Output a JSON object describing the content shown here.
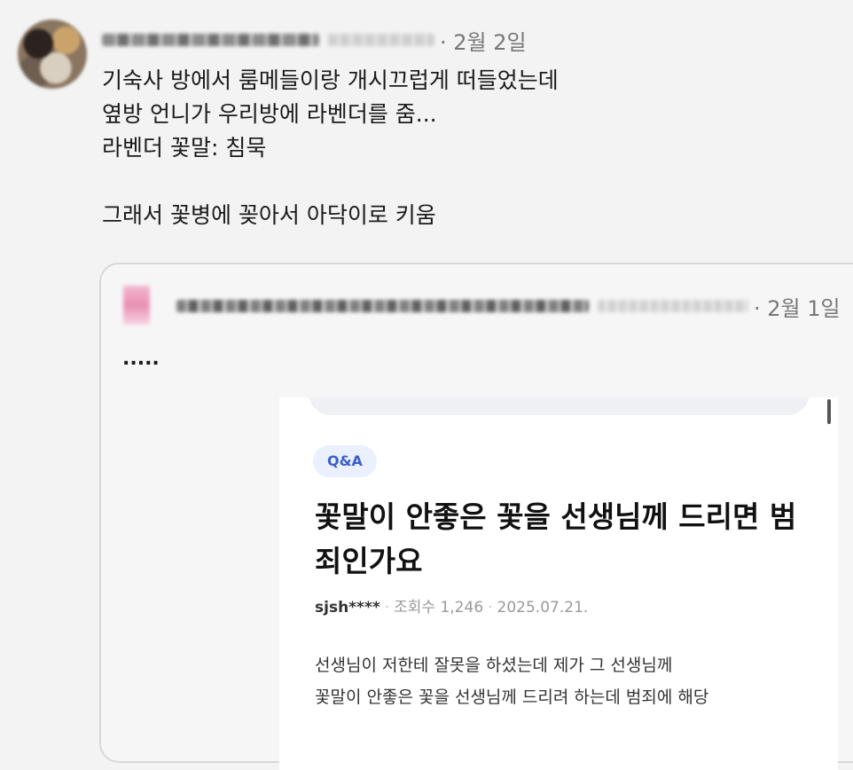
{
  "post": {
    "date": "· 2월 2일",
    "lines": [
      "기숙사 방에서 룸메들이랑 개시끄럽게 떠들었는데",
      "옆방 언니가 우리방에 라벤더를 줌...",
      "라벤더 꽃말: 침묵",
      "",
      "그래서 꽃병에 꽂아서 아닥이로 키움"
    ]
  },
  "quote": {
    "date": "· 2월 1일",
    "text": ".....",
    "screenshot": {
      "badge": "Q&A",
      "title": "꽃말이 안좋은 꽃을 선생님께 드리면 범죄인가요",
      "author": "sjsh****",
      "views": "조회수 1,246",
      "date": "2025.07.21.",
      "body_lines": [
        "선생님이 저한테 잘못을 하셨는데 제가 그 선생님께",
        "꽃말이 안좋은 꽃을 선생님께 드리려 하는데 범죄에 해당"
      ]
    }
  }
}
